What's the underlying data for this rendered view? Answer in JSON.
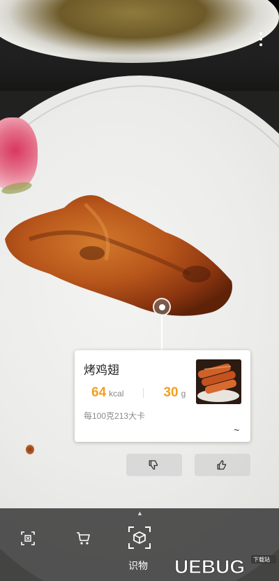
{
  "result_card": {
    "food_name": "烤鸡翅",
    "calories_value": "64",
    "calories_unit": "kcal",
    "weight_value": "30",
    "weight_unit": "g",
    "per_100g_text": "每100克213大卡",
    "expand_glyph": "~"
  },
  "bottom_bar": {
    "active_tab_label": "识物",
    "tabs": [
      {
        "icon": "scan-translate-icon"
      },
      {
        "icon": "shopping-cart-icon"
      },
      {
        "icon": "object-recognition-icon"
      }
    ]
  },
  "watermark": {
    "text": "UEBUG",
    "badge": "下载站"
  },
  "colors": {
    "accent_orange": "#f0a020",
    "card_bg": "#ffffff",
    "bottom_bar_bg": "#464646"
  }
}
